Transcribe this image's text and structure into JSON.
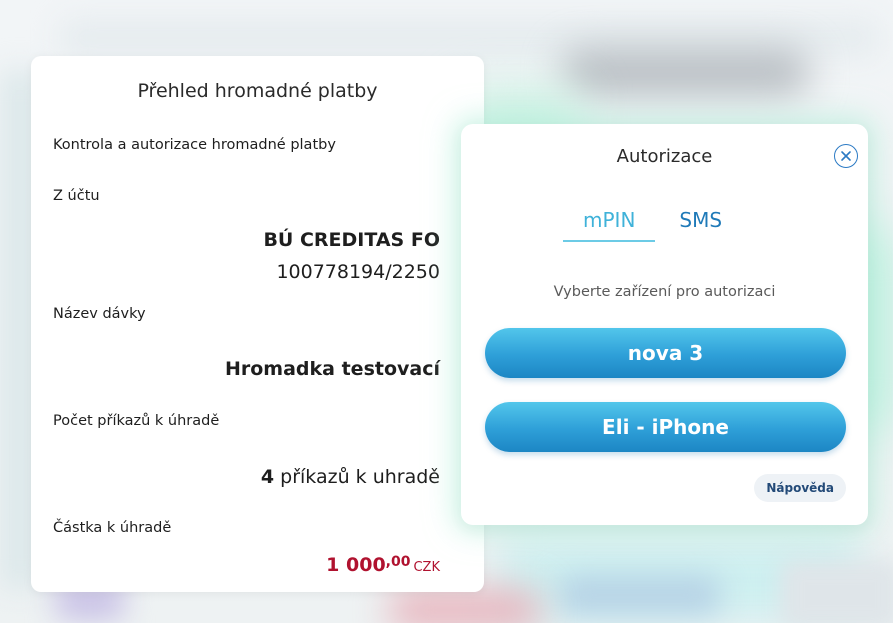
{
  "overview": {
    "title": "Přehled hromadné platby",
    "subtitle": "Kontrola a autorizace hromadné platby",
    "from_account_label": "Z účtu",
    "account_name": "BÚ CREDITAS FO",
    "account_number": "100778194/2250",
    "batch_name_label": "Název dávky",
    "batch_name": "Hromadka testovací",
    "orders_count_label": "Počet příkazů k úhradě",
    "orders_count": "4",
    "orders_count_suffix": "příkazů k uhradě",
    "amount_label": "Částka k úhradě",
    "amount_integer": "1 000",
    "amount_decimal": ",00",
    "amount_currency": "CZK"
  },
  "auth": {
    "title": "Autorizace",
    "tabs": [
      {
        "label": "mPIN",
        "active": true
      },
      {
        "label": "SMS",
        "active": false
      }
    ],
    "hint": "Vyberte zařízení pro autorizaci",
    "devices": [
      {
        "label": "nova 3"
      },
      {
        "label": "Eli - iPhone"
      }
    ],
    "help_label": "Nápověda"
  },
  "icons": {
    "close": "close-circle-icon"
  },
  "colors": {
    "accent": "#2e9fd8",
    "amount": "#b0122f",
    "tab_active": "#3fb2d9",
    "tab_inactive": "#1f7ab8",
    "glow": "#aaecd6"
  }
}
